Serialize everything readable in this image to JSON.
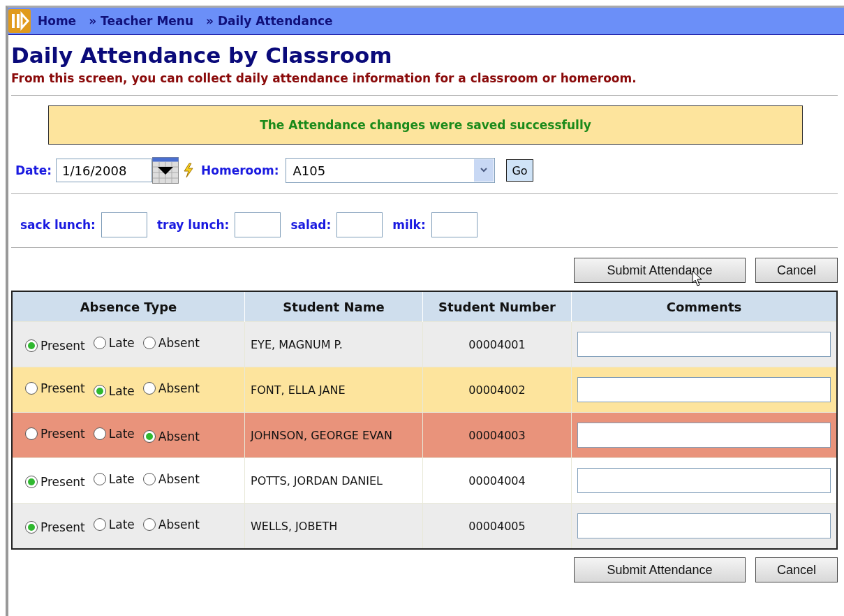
{
  "breadcrumbs": [
    "Home",
    "» Teacher Menu",
    "» Daily Attendance"
  ],
  "title": "Daily Attendance by Classroom",
  "subtitle": "From this screen, you can collect daily attendance information for a classroom or homeroom.",
  "message": "The Attendance changes were saved successfully",
  "date": {
    "label": "Date:",
    "value": "1/16/2008"
  },
  "homeroom": {
    "label": "Homeroom:",
    "value": "A105"
  },
  "go_button": "Go",
  "lunch_fields": [
    {
      "label": "sack lunch:"
    },
    {
      "label": "tray lunch:"
    },
    {
      "label": "salad:"
    },
    {
      "label": "milk:"
    }
  ],
  "buttons": [
    "Submit Attendance",
    "Cancel"
  ],
  "table": {
    "columns": [
      "Absence Type",
      "Student Name",
      "Student Number",
      "Comments"
    ],
    "rows": [
      {
        "options": [
          {
            "label": "Present",
            "selected": true
          },
          {
            "label": "Late",
            "selected": false
          },
          {
            "label": "Absent",
            "selected": false
          }
        ],
        "name": "EYE, MAGNUM P.",
        "number": "00004001"
      },
      {
        "options": [
          {
            "label": "Present",
            "selected": false
          },
          {
            "label": "Late",
            "selected": true
          },
          {
            "label": "Absent",
            "selected": false
          }
        ],
        "name": "FONT, ELLA JANE",
        "number": "00004002"
      },
      {
        "options": [
          {
            "label": "Present",
            "selected": false
          },
          {
            "label": "Late",
            "selected": false
          },
          {
            "label": "Absent",
            "selected": true
          }
        ],
        "name": "JOHNSON, GEORGE EVAN",
        "number": "00004003"
      },
      {
        "options": [
          {
            "label": "Present",
            "selected": true
          },
          {
            "label": "Late",
            "selected": false
          },
          {
            "label": "Absent",
            "selected": false
          }
        ],
        "name": "POTTS, JORDAN DANIEL",
        "number": "00004004"
      },
      {
        "options": [
          {
            "label": "Present",
            "selected": true
          },
          {
            "label": "Late",
            "selected": false
          },
          {
            "label": "Absent",
            "selected": false
          }
        ],
        "name": "WELLS, JOBETH",
        "number": "00004005"
      }
    ]
  },
  "bottom_buttons": [
    "Submit Attendance",
    "Cancel"
  ]
}
